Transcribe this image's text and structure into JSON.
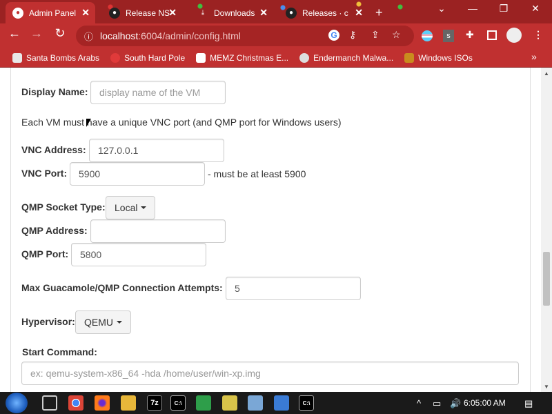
{
  "browser": {
    "tabs": [
      {
        "title": "Admin Panel",
        "active": true
      },
      {
        "title": "Release NS",
        "active": false
      },
      {
        "title": "Downloads",
        "active": false
      },
      {
        "title": "Releases · c",
        "active": false
      }
    ],
    "new_tab": "+",
    "window_controls": {
      "dropdown": "⌄",
      "minimize": "—",
      "restore": "❐",
      "close": "✕"
    },
    "nav": {
      "back": "←",
      "forward": "→",
      "reload": "↻"
    },
    "url": {
      "host": "localhost",
      "path": ":6004/admin/config.html"
    },
    "bookmarks": [
      {
        "label": "Santa Bombs Arabs",
        "icon_color": "#e8e8e8"
      },
      {
        "label": "South Hard Pole",
        "icon_color": "#e03a3a"
      },
      {
        "label": "MEMZ Christmas E...",
        "icon_color": "#ffffff"
      },
      {
        "label": "Endermanch Malwa...",
        "icon_color": "#dddddd"
      },
      {
        "label": "Windows ISOs",
        "icon_color": "#c98b1e"
      }
    ],
    "more_bookmarks": "»",
    "accent": "#c03030"
  },
  "form": {
    "display_name": {
      "label": "Display Name:",
      "placeholder": "display name of the VM"
    },
    "vnc_note": "Each VM must have a unique VNC port (and QMP port for Windows users)",
    "vnc_address": {
      "label": "VNC Address:",
      "value": "127.0.0.1"
    },
    "vnc_port": {
      "label": "VNC Port:",
      "value": "5900",
      "hint": "- must be at least 5900"
    },
    "qmp_socket_type": {
      "label": "QMP Socket Type:",
      "value": "Local"
    },
    "qmp_address": {
      "label": "QMP Address:",
      "value": ""
    },
    "qmp_port": {
      "label": "QMP Port:",
      "value": "5800"
    },
    "max_attempts": {
      "label": "Max Guacamole/QMP Connection Attempts:",
      "value": "5"
    },
    "hypervisor": {
      "label": "Hypervisor:",
      "value": "QEMU"
    },
    "start_command": {
      "label": "Start Command:",
      "placeholder": "ex: qemu-system-x86_64 -hda /home/user/win-xp.img"
    }
  },
  "taskbar": {
    "apps": [
      "chrome",
      "firefox",
      "explorer",
      "7z",
      "cmd",
      "notepad",
      "pencil",
      "network",
      "window",
      "terminal"
    ],
    "app_labels": {
      "seven_zip": "7z",
      "cmd": "C:\\"
    },
    "clock": "6:05:00 AM",
    "tray_arrow": "^",
    "notification": "▤"
  }
}
